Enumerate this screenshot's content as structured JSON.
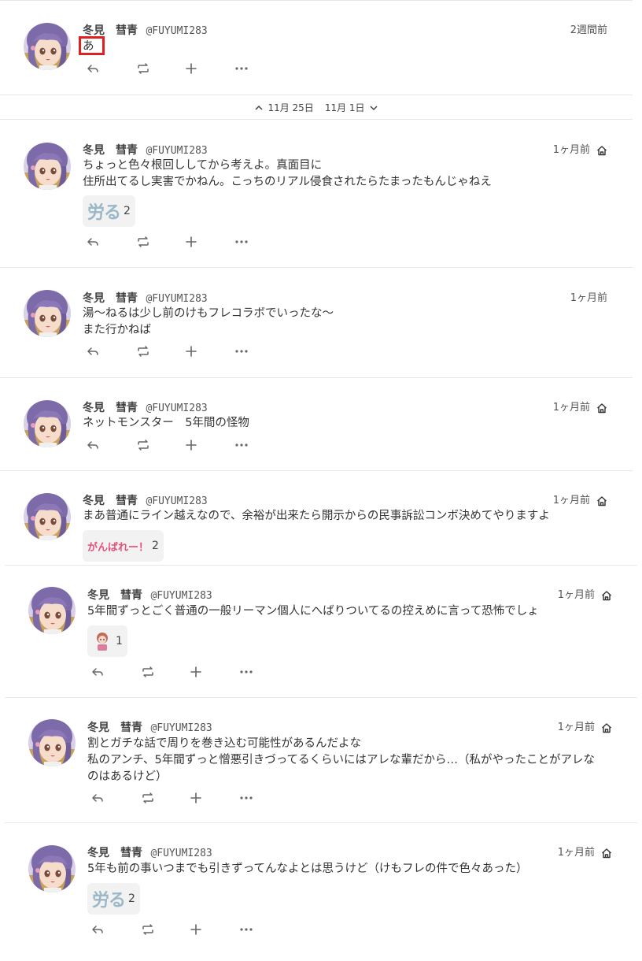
{
  "user": {
    "name": "冬見　彗青",
    "handle": "@FUYUMI283"
  },
  "date_separator": {
    "prev": "11月 25日",
    "next": "11月 1日"
  },
  "icons": {
    "reply": "reply-icon",
    "renote": "renote-icon",
    "react": "plus-icon",
    "more": "more-icon",
    "visibility": "home-icon"
  },
  "notes": [
    {
      "time": "2週間前",
      "home": false,
      "lines": [
        "あ"
      ],
      "reaction": null
    },
    {
      "time": "1ヶ月前",
      "home": true,
      "lines": [
        "ちょっと色々根回ししてから考えよ。真面目に",
        "住所出てるし実害でかねん。こっちのリアル侵食されたらたまったもんじゃねえ"
      ],
      "reaction": {
        "emoji": "労る",
        "count": "2"
      }
    },
    {
      "time": "1ヶ月前",
      "home": false,
      "lines": [
        "湯～ねるは少し前のけもフレコラボでいったな～",
        "また行かねば"
      ],
      "reaction": null
    },
    {
      "time": "1ヶ月前",
      "home": true,
      "lines": [
        "ネットモンスター　5年間の怪物"
      ],
      "reaction": null
    },
    {
      "time": "1ヶ月前",
      "home": true,
      "lines": [
        "まあ普通にライン越えなので、余裕が出来たら開示からの民事訴訟コンボ決めてやりますよ"
      ],
      "reaction": {
        "emoji": "がんばれー！",
        "count": "2"
      }
    },
    {
      "time": "1ヶ月前",
      "home": true,
      "lines": [
        "5年間ずっとごく普通の一般リーマン個人にへばりついてるの控えめに言って恐怖でしょ"
      ],
      "reaction": {
        "emoji": "character-sticker",
        "count": "1"
      }
    },
    {
      "time": "1ヶ月前",
      "home": true,
      "lines": [
        "割とガチな話で周りを巻き込む可能性があるんだよな",
        "私のアンチ、5年間ずっと憎悪引きづってるくらいにはアレな輩だから…（私がやったことがアレな",
        "のはあるけど）"
      ],
      "reaction": null
    },
    {
      "time": "1ヶ月前",
      "home": true,
      "lines": [
        "5年も前の事いつまでも引きずってんなよとは思うけど（けもフレの件で色々あった）"
      ],
      "reaction": {
        "emoji": "労る",
        "count": "2"
      }
    }
  ]
}
